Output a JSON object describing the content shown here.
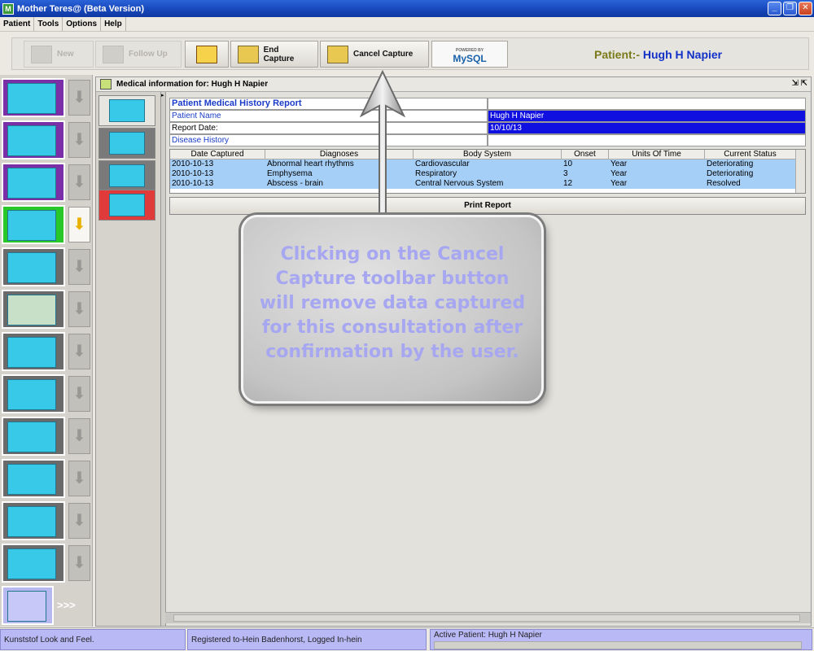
{
  "window": {
    "title": "Mother Teres@ (Beta Version)",
    "app_icon": "M"
  },
  "menu": [
    "Patient",
    "Tools",
    "Options",
    "Help"
  ],
  "toolbar": {
    "new_label": "New",
    "follow_up_label": "Follow Up",
    "end_capture_label": "End Capture",
    "cancel_capture_label": "Cancel Capture",
    "mysql_logo_label": "MySQL",
    "mysql_logo_small": "POWERED BY"
  },
  "patient_header": {
    "prefix": "Patient:-",
    "name": "Hugh H Napier"
  },
  "internal_frame": {
    "title": "Medical information for: Hugh H Napier"
  },
  "report": {
    "title": "Patient Medical History Report",
    "patient_name_label": "Patient Name",
    "patient_name_value": "Hugh H Napier",
    "report_date_label": "Report Date:",
    "report_date_value": "10/10/13",
    "disease_history_label": "Disease History",
    "columns": [
      "Date Captured",
      "Diagnoses",
      "Body System",
      "Onset",
      "Units Of Time",
      "Current Status"
    ],
    "rows": [
      [
        "2010-10-13",
        "Abnormal heart rhythms",
        "Cardiovascular",
        "10",
        "Year",
        "Deteriorating"
      ],
      [
        "2010-10-13",
        "Emphysema",
        "Respiratory",
        "3",
        "Year",
        "Deteriorating"
      ],
      [
        "2010-10-13",
        "Abscess - brain",
        "Central Nervous System",
        "12",
        "Year",
        "Resolved"
      ]
    ],
    "print_button": "Print Report"
  },
  "callout": {
    "lines": [
      "Clicking on the Cancel",
      "Capture toolbar button",
      "will remove data captured",
      "for this consultation after",
      "confirmation by the user."
    ]
  },
  "leftnav": {
    "more_label": ">>>"
  },
  "status": {
    "look": "Kunststof Look and Feel.",
    "registration": "Registered to-Hein Badenhorst, Logged In-hein",
    "active_patient": "Active Patient: Hugh H Napier"
  },
  "colors": {
    "accent": "#1010e0",
    "selection": "#a6cff7",
    "status": "#b9b9f6",
    "callout_text": "#a7a7f1"
  }
}
